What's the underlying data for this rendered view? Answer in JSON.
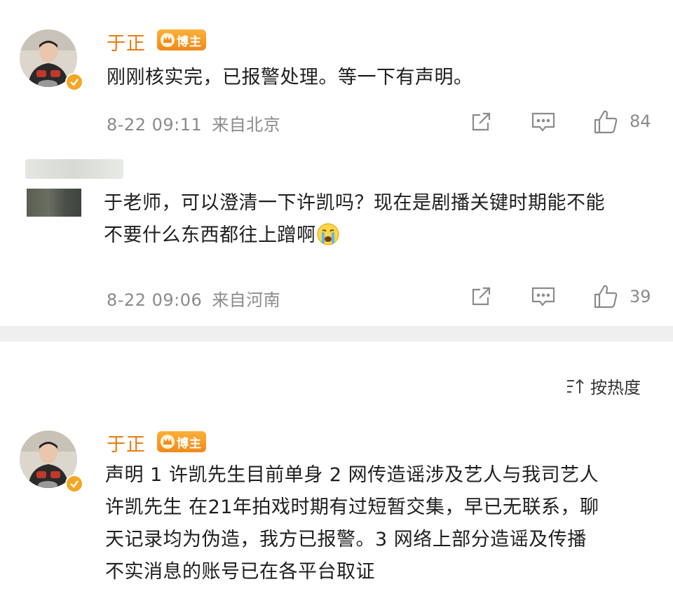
{
  "comments": [
    {
      "author": "于正",
      "badge": "博主",
      "text": "刚刚核实完，已报警处理。等一下有声明。",
      "date": "8-22 09:11",
      "location": "来自北京",
      "likes": "84"
    },
    {
      "text_line1": "于老师，可以澄清一下许凯吗？现在是剧播关键时期能不能",
      "text_line2": "不要什么东西都往上蹭啊",
      "emoji": "crying-face",
      "date": "8-22 09:06",
      "location": "来自河南",
      "likes": "39"
    }
  ],
  "sort": {
    "label": "按热度",
    "icon": "sort-icon"
  },
  "post": {
    "author": "于正",
    "badge": "博主",
    "lines": [
      "声明 1 许凯先生目前单身 2 网传造谣涉及艺人与我司艺人",
      "许凯先生 在21年拍戏时期有过短暂交集，早已无联系，聊",
      "天记录均为伪造，我方已报警。3 网络上部分造谣及传播",
      "不实消息的账号已在各平台取证"
    ]
  },
  "colors": {
    "author": "#ea7b12",
    "badge": "#f39a26",
    "meta": "#8a8a8a",
    "divider": "#efefef"
  }
}
